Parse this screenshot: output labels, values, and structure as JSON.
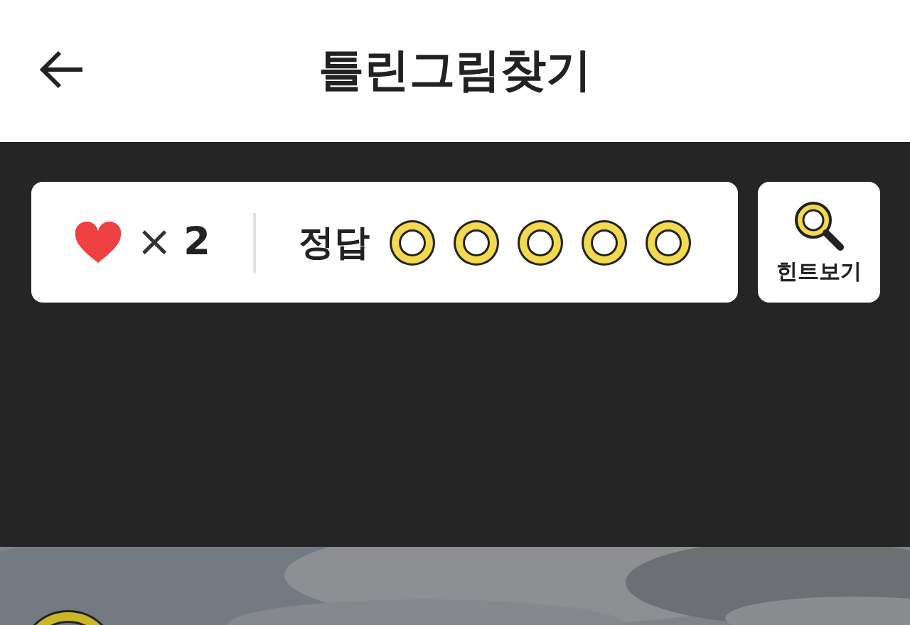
{
  "header": {
    "title": "틀린그림찾기"
  },
  "status": {
    "times_sign": "×",
    "lives": "2",
    "answers_label": "정답",
    "answers": [
      {
        "found": false
      },
      {
        "found": false
      },
      {
        "found": false
      },
      {
        "found": false
      },
      {
        "found": false
      }
    ]
  },
  "hint_button": {
    "label": "힌트보기"
  }
}
